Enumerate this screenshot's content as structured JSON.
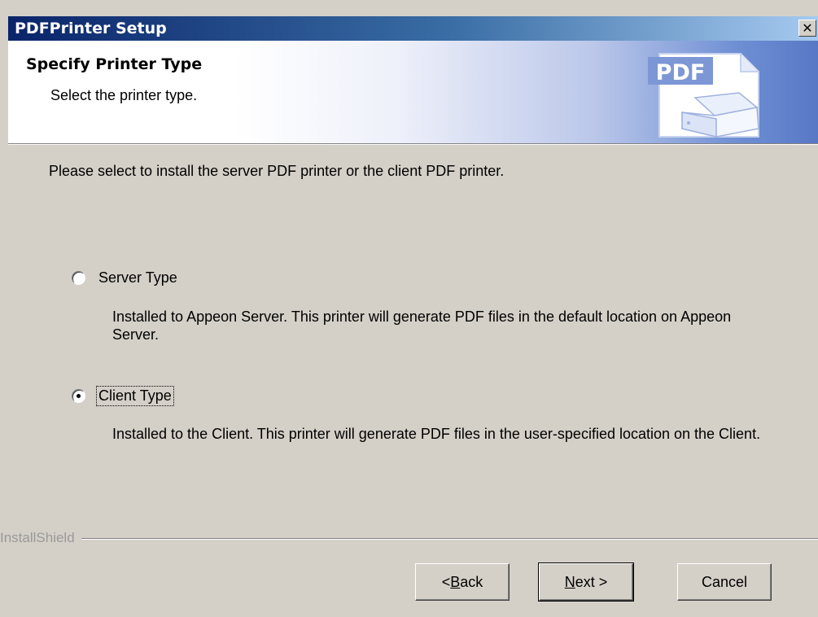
{
  "window": {
    "title": "PDFPrinter Setup",
    "close_glyph": "✕"
  },
  "header": {
    "title": "Specify Printer Type",
    "subtitle": "Select the printer type.",
    "logo_text": "PDF"
  },
  "content": {
    "intro": "Please select to install the server PDF printer or the client PDF printer.",
    "options": [
      {
        "label": "Server Type",
        "description": "Installed to Appeon Server.  This printer will generate PDF files in the default location on Appeon Server.",
        "selected": false
      },
      {
        "label": "Client Type",
        "description": "Installed to the Client.  This printer will generate PDF files in the user-specified location on the Client.",
        "selected": true
      }
    ]
  },
  "footer": {
    "brand": "InstallShield",
    "buttons": {
      "back": "< Back",
      "next": "Next >",
      "cancel": "Cancel"
    }
  }
}
